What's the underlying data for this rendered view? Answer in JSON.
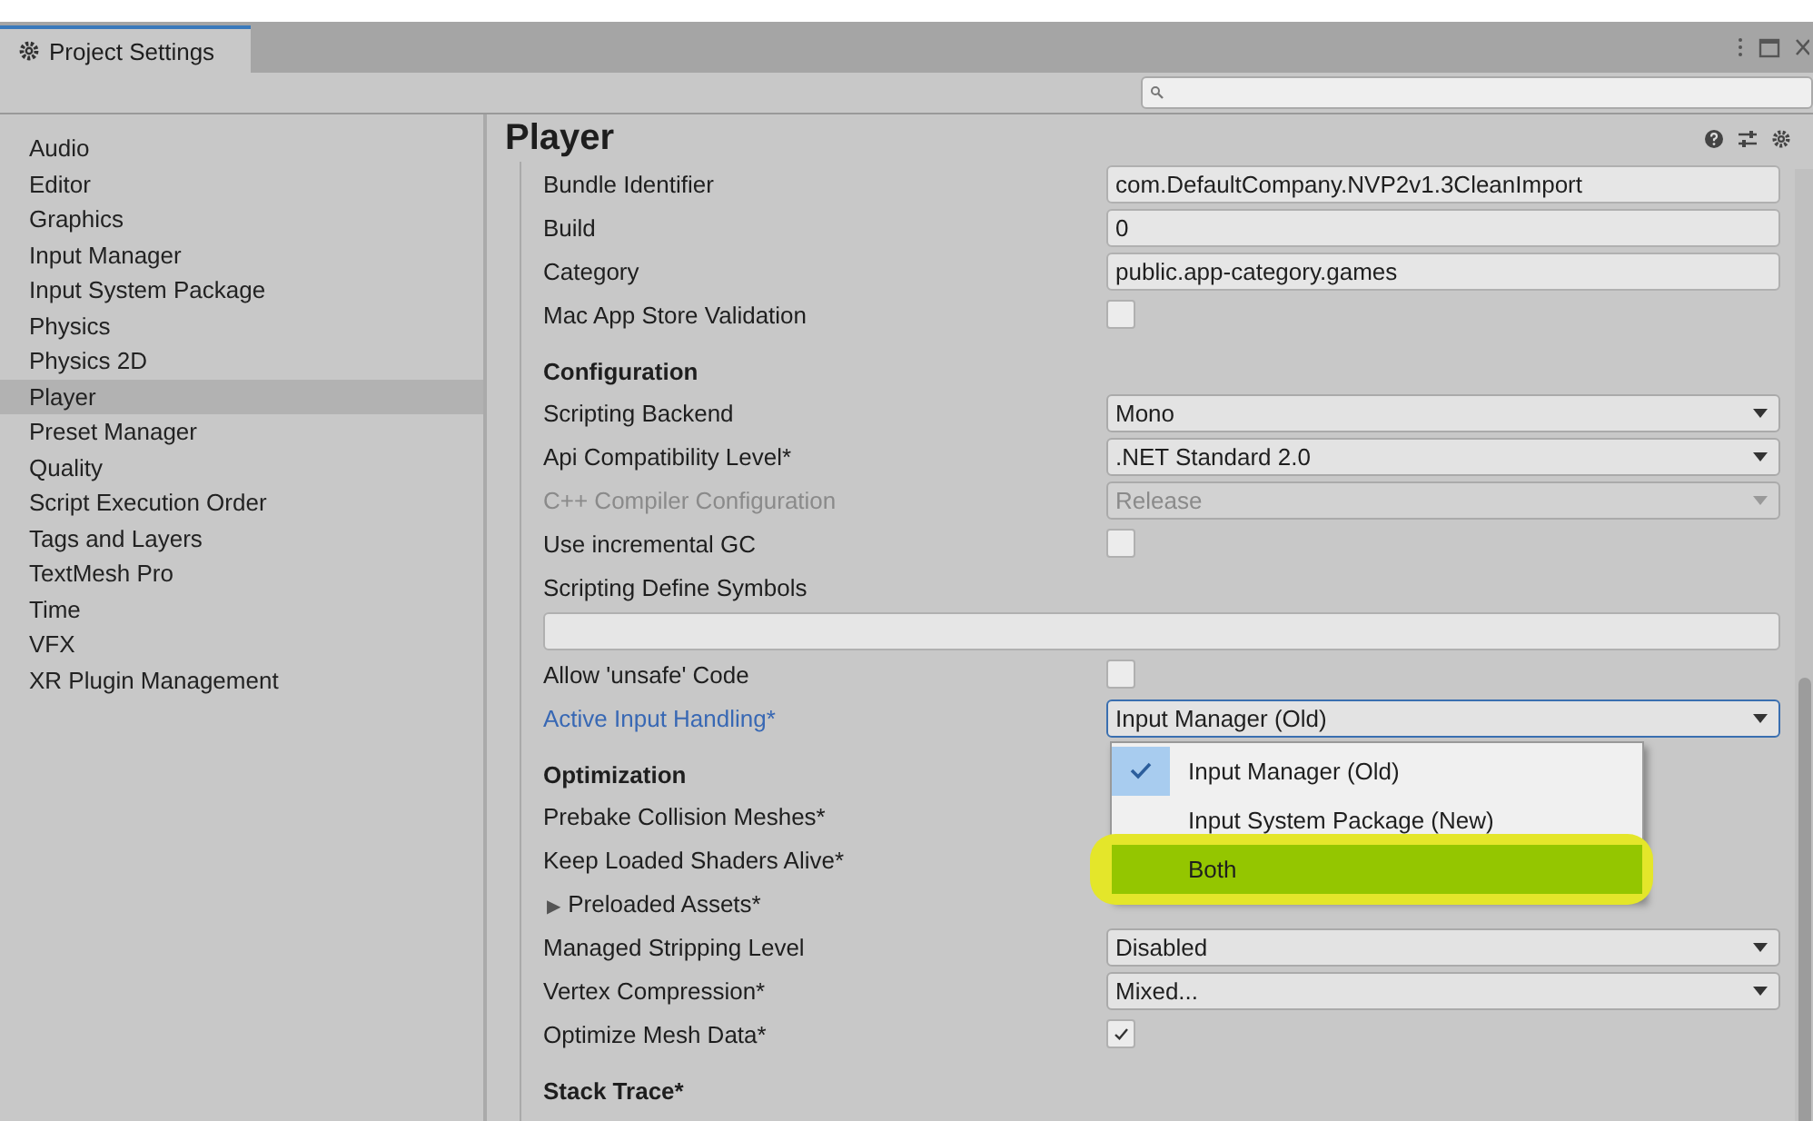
{
  "window": {
    "tab": {
      "title": "Project Settings",
      "selected": true
    }
  },
  "sidebar": {
    "items": [
      {
        "label": "Audio",
        "selected": false
      },
      {
        "label": "Editor",
        "selected": false
      },
      {
        "label": "Graphics",
        "selected": false
      },
      {
        "label": "Input Manager",
        "selected": false
      },
      {
        "label": "Input System Package",
        "selected": false
      },
      {
        "label": "Physics",
        "selected": false
      },
      {
        "label": "Physics 2D",
        "selected": false
      },
      {
        "label": "Player",
        "selected": true
      },
      {
        "label": "Preset Manager",
        "selected": false
      },
      {
        "label": "Quality",
        "selected": false
      },
      {
        "label": "Script Execution Order",
        "selected": false
      },
      {
        "label": "Tags and Layers",
        "selected": false
      },
      {
        "label": "TextMesh Pro",
        "selected": false
      },
      {
        "label": "Time",
        "selected": false
      },
      {
        "label": "VFX",
        "selected": false
      },
      {
        "label": "XR Plugin Management",
        "selected": false
      }
    ]
  },
  "panel": {
    "title": "Player",
    "rows": [
      {
        "kind": "text",
        "label": "Bundle Identifier",
        "value": "com.DefaultCompany.NVP2v1.3CleanImport"
      },
      {
        "kind": "text",
        "label": "Build",
        "value": "0"
      },
      {
        "kind": "text",
        "label": "Category",
        "value": "public.app-category.games"
      },
      {
        "kind": "checkbox",
        "label": "Mac App Store Validation",
        "checked": false
      },
      {
        "kind": "header",
        "label": "Configuration"
      },
      {
        "kind": "dropdown",
        "label": "Scripting Backend",
        "value": "Mono",
        "disabled": false,
        "focused": false
      },
      {
        "kind": "dropdown",
        "label": "Api Compatibility Level*",
        "value": ".NET Standard 2.0",
        "disabled": false,
        "focused": false
      },
      {
        "kind": "dropdown",
        "label": "C++ Compiler Configuration",
        "value": "Release",
        "disabled": true,
        "focused": false
      },
      {
        "kind": "checkbox",
        "label": "Use incremental GC",
        "checked": false
      },
      {
        "kind": "label",
        "label": "Scripting Define Symbols"
      },
      {
        "kind": "wide_text"
      },
      {
        "kind": "checkbox",
        "label": "Allow 'unsafe' Code",
        "checked": false
      },
      {
        "kind": "dropdown",
        "label": "Active Input Handling*",
        "value": "Input Manager (Old)",
        "disabled": false,
        "focused": true,
        "menu": [
          {
            "label": "Input Manager (Old)",
            "checked": true,
            "highlighted": false
          },
          {
            "label": "Input System Package (New)",
            "checked": false,
            "highlighted": false
          },
          {
            "label": "Both",
            "checked": false,
            "highlighted": true
          }
        ]
      },
      {
        "kind": "header",
        "label": "Optimization"
      },
      {
        "kind": "label",
        "label": "Prebake Collision Meshes*"
      },
      {
        "kind": "label",
        "label": "Keep Loaded Shaders Alive*"
      },
      {
        "kind": "foldout",
        "label": "Preloaded Assets*",
        "arrow": "▶",
        "expanded": false
      },
      {
        "kind": "dropdown",
        "label": "Managed Stripping Level",
        "value": "Disabled",
        "disabled": false,
        "focused": false
      },
      {
        "kind": "dropdown",
        "label": "Vertex Compression*",
        "value": "Mixed...",
        "disabled": false,
        "focused": false
      },
      {
        "kind": "checkbox",
        "label": "Optimize Mesh Data*",
        "checked": true
      },
      {
        "kind": "header",
        "label": "Stack Trace*"
      }
    ]
  }
}
